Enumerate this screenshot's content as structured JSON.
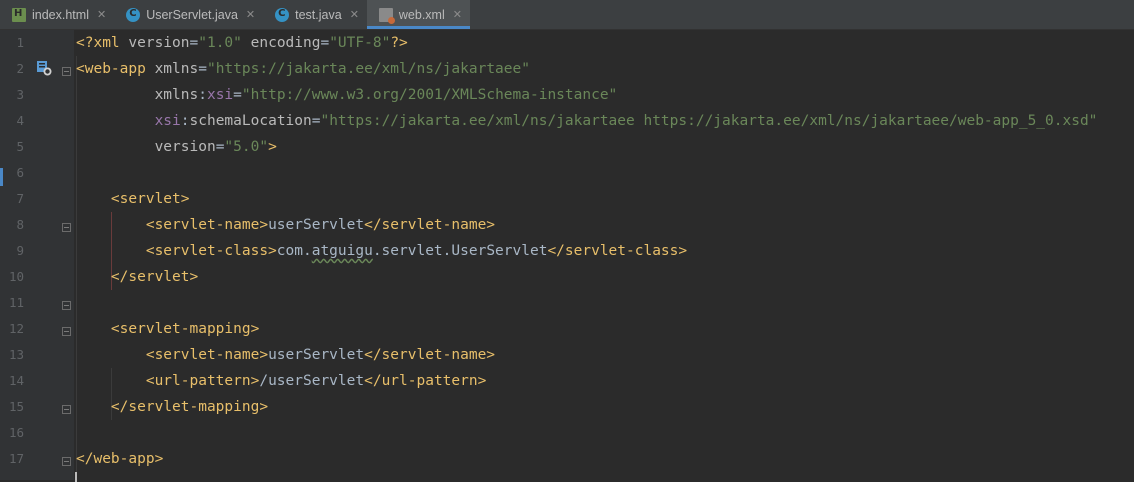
{
  "tabs": [
    {
      "label": "index.html",
      "icon": "html-file-icon",
      "active": false
    },
    {
      "label": "UserServlet.java",
      "icon": "java-class-icon",
      "active": false
    },
    {
      "label": "test.java",
      "icon": "java-class-icon",
      "active": false
    },
    {
      "label": "web.xml",
      "icon": "xml-file-icon",
      "active": true
    }
  ],
  "close_glyph": "✕",
  "colors": {
    "background": "#2b2b2b",
    "gutter": "#313335",
    "tag": "#e8bf6a",
    "attribute": "#bababa",
    "namespace": "#9876aa",
    "string": "#6a8759",
    "text": "#a9b7c6",
    "line_number": "#606366",
    "active_tab_accent": "#4a88c7"
  },
  "line_numbers": [
    "1",
    "2",
    "3",
    "4",
    "5",
    "6",
    "7",
    "8",
    "9",
    "10",
    "11",
    "12",
    "13",
    "14",
    "15",
    "16",
    "17"
  ],
  "code": {
    "l1": {
      "a": "<?xml ",
      "b": "version",
      "c": "=",
      "d": "\"1.0\"",
      "e": " ",
      "f": "encoding",
      "g": "=",
      "h": "\"UTF-8\"",
      "i": "?>"
    },
    "l2": {
      "a": "<web-app ",
      "b": "xmlns",
      "c": "=",
      "d": "\"https://jakarta.ee/xml/ns/jakartaee\""
    },
    "l3": {
      "indent": "         ",
      "a": "xmlns",
      "b": ":",
      "c": "xsi",
      "d": "=",
      "e": "\"http://www.w3.org/2001/XMLSchema-instance\""
    },
    "l4": {
      "indent": "         ",
      "a": "xsi",
      "b": ":",
      "c": "schemaLocation",
      "d": "=",
      "e": "\"https://jakarta.ee/xml/ns/jakartaee https://jakarta.ee/xml/ns/jakartaee/web-app_5_0.xsd\""
    },
    "l5": {
      "indent": "         ",
      "a": "version",
      "b": "=",
      "c": "\"5.0\"",
      "d": ">"
    },
    "l7": {
      "indent": "    ",
      "a": "<servlet>"
    },
    "l8": {
      "indent": "        ",
      "a": "<servlet-name>",
      "b": "userServlet",
      "c": "</servlet-name>"
    },
    "l9": {
      "indent": "        ",
      "a": "<servlet-class>",
      "b1": "com.",
      "b2": "atguigu",
      "b3": ".servlet.UserServlet",
      "c": "</servlet-class>"
    },
    "l10": {
      "indent": "    ",
      "a": "</servlet>"
    },
    "l12": {
      "indent": "    ",
      "a": "<servlet-mapping>"
    },
    "l13": {
      "indent": "        ",
      "a": "<servlet-name>",
      "b": "userServlet",
      "c": "</servlet-name>"
    },
    "l14": {
      "indent": "        ",
      "a": "<url-pattern>",
      "b": "/userServlet",
      "c": "</url-pattern>"
    },
    "l15": {
      "indent": "    ",
      "a": "</servlet-mapping>"
    },
    "l17": {
      "a": "</web-app>"
    }
  }
}
